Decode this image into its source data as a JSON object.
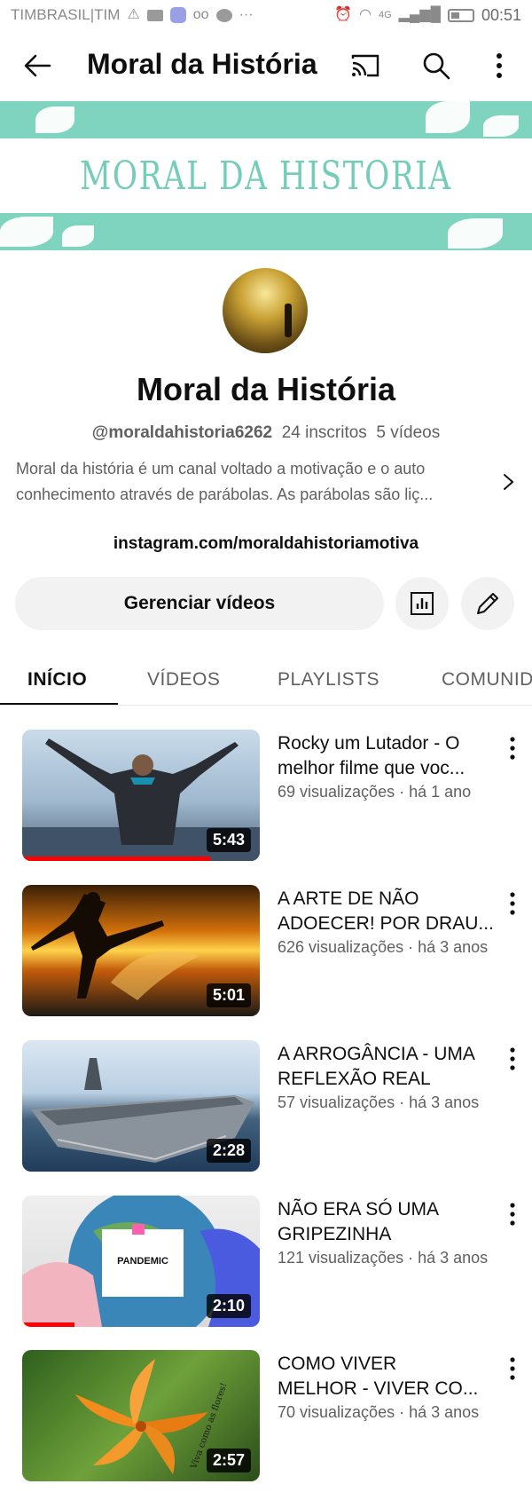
{
  "status_bar": {
    "carrier": "TIMBRASIL|TIM",
    "network_label": "4G",
    "time": "00:51"
  },
  "app_bar": {
    "title": "Moral da História",
    "icons": [
      "back-arrow-icon",
      "cast-icon",
      "search-icon",
      "more-vert-icon"
    ]
  },
  "banner": {
    "text": "MORAL DA HISTORIA",
    "bg_color": "#7fd4bf",
    "text_color": "#73cdb8"
  },
  "channel": {
    "name": "Moral da História",
    "handle": "@moraldahistoria6262",
    "subscribers": "24 inscritos",
    "video_count": "5 vídeos",
    "description_line1": "Moral da história é um canal voltado a motivação e o auto",
    "description_line2": "conhecimento através de parábolas. As parábolas são liç...",
    "link": "instagram.com/moraldahistoriamotiva"
  },
  "actions": {
    "manage_label": "Gerenciar vídeos",
    "stats_icon": "analytics-icon",
    "edit_icon": "edit-pencil-icon"
  },
  "tabs": [
    {
      "label": "INÍCIO",
      "active": true
    },
    {
      "label": "VÍDEOS",
      "active": false
    },
    {
      "label": "PLAYLISTS",
      "active": false
    },
    {
      "label": "COMUNIDADE",
      "active": false
    }
  ],
  "videos": [
    {
      "title_line1": "Rocky um Lutador - O",
      "title_line2": "melhor filme que voc...",
      "meta": "69 visualizações · há 1 ano",
      "duration": "5:43",
      "watched_fraction": 0.79
    },
    {
      "title_line1": "A ARTE DE NÃO",
      "title_line2": "ADOECER! POR DRAU...",
      "meta": "626 visualizações · há 3 anos",
      "duration": "5:01",
      "watched_fraction": 0
    },
    {
      "title_line1": "A ARROGÂNCIA - UMA",
      "title_line2": "REFLEXÃO REAL",
      "meta": "57 visualizações · há 3 anos",
      "duration": "2:28",
      "watched_fraction": 0
    },
    {
      "title_line1": "NÃO ERA SÓ UMA",
      "title_line2": "GRIPEZINHA",
      "meta": "121 visualizações · há 3 anos",
      "duration": "2:10",
      "watched_fraction": 0.22,
      "thumb_text": "PANDEMIC"
    },
    {
      "title_line1": "COMO VIVER",
      "title_line2": "MELHOR - VIVER CO...",
      "meta": "70 visualizações · há 3 anos",
      "duration": "2:57",
      "watched_fraction": 0,
      "thumb_text": "Viva como as flores!"
    }
  ]
}
